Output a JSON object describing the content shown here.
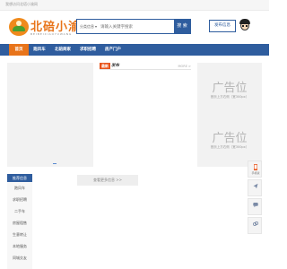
{
  "topbar": {
    "welcome": "我想访问北塔小渝网"
  },
  "logo": {
    "name": "北碚小渝网",
    "sub": "BEIBEIXIAOYUWANG"
  },
  "search": {
    "category": "分类信息",
    "placeholder": "请输入关键字搜索",
    "button": "搜 索"
  },
  "post_button": "发布信息",
  "nav": {
    "items": [
      "首页",
      "跑风车",
      "北碚商家",
      "求职招聘",
      "房产门户"
    ],
    "active_index": 0
  },
  "news": {
    "tag": "最新",
    "title": "发布",
    "more": "MORE >"
  },
  "ads": [
    {
      "big": "广告位",
      "small": "首页上方右侧（宽300px）"
    },
    {
      "big": "广告位",
      "small": "首页上方右侧（宽300px）"
    }
  ],
  "sidebar": {
    "title": "推荐信息",
    "items": [
      "跑风车",
      "求职招聘",
      "二手车",
      "房屋租售",
      "生意转让",
      "本地服务",
      "同城交友"
    ]
  },
  "more_button": "查看更多信息 >>",
  "float_bar": [
    {
      "icon": "phone-icon",
      "label": "手机版"
    },
    {
      "icon": "share-icon",
      "label": ""
    },
    {
      "icon": "chat-icon",
      "label": ""
    },
    {
      "icon": "link-icon",
      "label": ""
    }
  ],
  "colors": {
    "primary": "#2f5d9e",
    "accent": "#e8741a",
    "tag": "#e8541a"
  }
}
